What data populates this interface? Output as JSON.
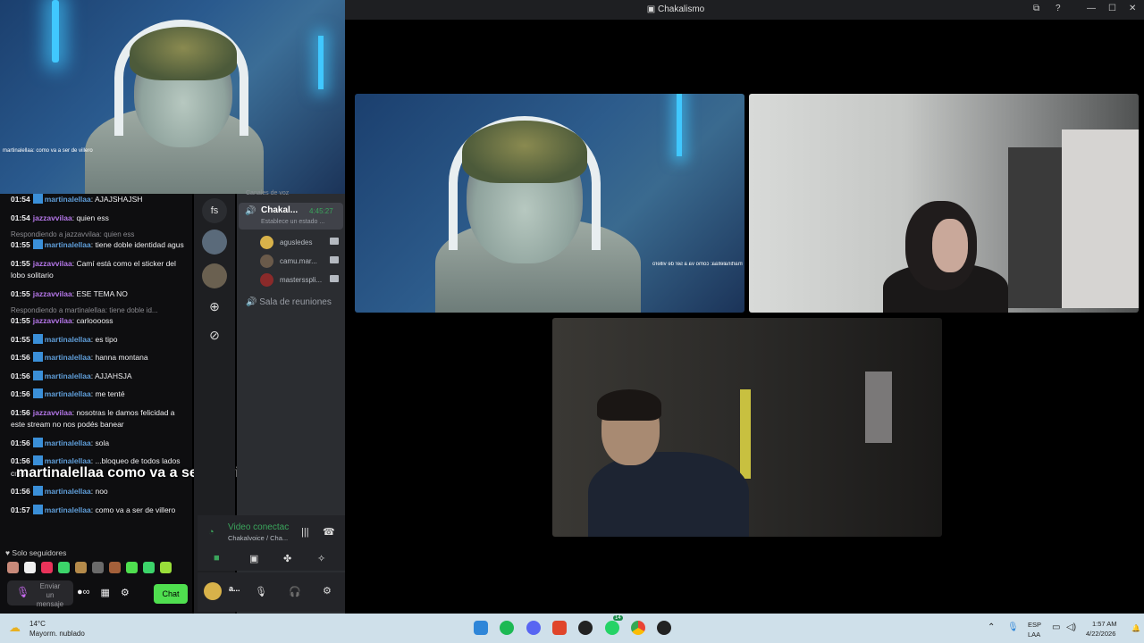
{
  "stream_cam": {
    "caption": "martinalellaa: como va a ser de villero"
  },
  "chat": {
    "messages": [
      {
        "time": "01:54",
        "user": "martinalellaa",
        "user_type": "u1",
        "badge": true,
        "text": "AJAJSHAJSH",
        "reply": ""
      },
      {
        "time": "01:54",
        "user": "jazzavvilaa",
        "user_type": "u2",
        "badge": false,
        "text": "quien ess",
        "reply": ""
      },
      {
        "time": "01:55",
        "user": "martinalellaa",
        "user_type": "u1",
        "badge": true,
        "text": "tiene doble identidad agus",
        "reply": "Respondiendo a jazzavvilaa: quien ess"
      },
      {
        "time": "01:55",
        "user": "jazzavvilaa",
        "user_type": "u2",
        "badge": false,
        "text": "Camí está como el sticker del lobo solitario",
        "reply": ""
      },
      {
        "time": "01:55",
        "user": "jazzavvilaa",
        "user_type": "u2",
        "badge": false,
        "text": "ESE TEMA NO",
        "reply": ""
      },
      {
        "time": "01:55",
        "user": "jazzavvilaa",
        "user_type": "u2",
        "badge": false,
        "text": "carlooooss",
        "reply": "Respondiendo a martinalellaa: tiene doble id..."
      },
      {
        "time": "01:55",
        "user": "martinalellaa",
        "user_type": "u1",
        "badge": true,
        "text": "es tipo",
        "reply": ""
      },
      {
        "time": "01:56",
        "user": "martinalellaa",
        "user_type": "u1",
        "badge": true,
        "text": "hanna montana",
        "reply": ""
      },
      {
        "time": "01:56",
        "user": "martinalellaa",
        "user_type": "u1",
        "badge": true,
        "text": "AJJAHSJA",
        "reply": ""
      },
      {
        "time": "01:56",
        "user": "martinalellaa",
        "user_type": "u1",
        "badge": true,
        "text": "me tenté",
        "reply": ""
      },
      {
        "time": "01:56",
        "user": "jazzavvilaa",
        "user_type": "u2",
        "badge": false,
        "text": "nosotras le damos felicidad a este stream no nos podés banear",
        "reply": ""
      },
      {
        "time": "01:56",
        "user": "martinalellaa",
        "user_type": "u1",
        "badge": true,
        "text": "sola",
        "reply": ""
      },
      {
        "time": "01:56",
        "user": "martinalellaa",
        "user_type": "u1",
        "badge": true,
        "text": "...bloqueo de todos lados creo",
        "reply": ""
      },
      {
        "time": "01:56",
        "user": "martinalellaa",
        "user_type": "u1",
        "badge": true,
        "text": "noo",
        "reply": ""
      },
      {
        "time": "01:57",
        "user": "martinalellaa",
        "user_type": "u1",
        "badge": true,
        "text": "como va a ser de villero",
        "reply": ""
      }
    ],
    "overlay_text": "martinalellaa como va a ser de villero",
    "followers_only": "Solo seguidores",
    "input_placeholder": "Enviar un mensaje",
    "chat_button": "Chat"
  },
  "discord": {
    "server_label": "fs",
    "voice_header": "Canales de voz",
    "active_channel": "Chakal...",
    "timer": "4:45:27",
    "status_placeholder": "Establece un estado ...",
    "users": [
      {
        "name": "agusledes",
        "color": "#d8b24a"
      },
      {
        "name": "camu.mar...",
        "color": "#6a5a4a"
      },
      {
        "name": "mastersspli...",
        "color": "#8a2a2a"
      }
    ],
    "meeting_room": "Sala de reuniones",
    "voice_panel_title": "Video conectac",
    "voice_panel_sub": "Chakalvoice / Cha...",
    "user_name": "a..."
  },
  "call_window": {
    "title": "Chakalismo",
    "tile1_caption": "martinalellaa: como va a ser de villero"
  },
  "taskbar": {
    "temp": "14°C",
    "weather": "Mayorm. nublado",
    "lang1": "ESP",
    "lang2": "LAA",
    "time": "1:57 AM",
    "date": "4/22/2026",
    "whatsapp_badge": "14"
  }
}
